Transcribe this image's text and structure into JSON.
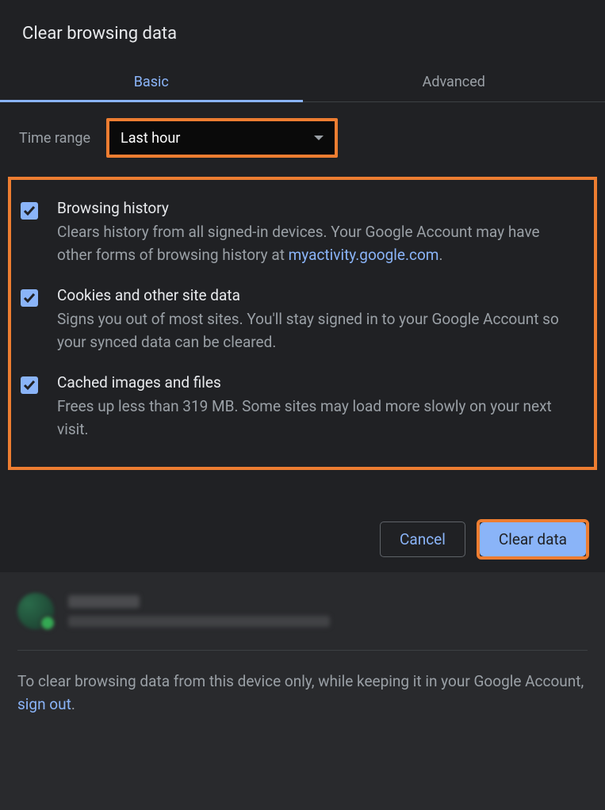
{
  "dialog": {
    "title": "Clear browsing data"
  },
  "tabs": {
    "basic": "Basic",
    "advanced": "Advanced"
  },
  "timeRange": {
    "label": "Time range",
    "value": "Last hour"
  },
  "options": {
    "browsingHistory": {
      "title": "Browsing history",
      "descPrefix": "Clears history from all signed-in devices. Your Google Account may have other forms of browsing history at ",
      "link": "myactivity.google.com",
      "descSuffix": ".",
      "checked": true
    },
    "cookies": {
      "title": "Cookies and other site data",
      "desc": "Signs you out of most sites. You'll stay signed in to your Google Account so your synced data can be cleared.",
      "checked": true
    },
    "cache": {
      "title": "Cached images and files",
      "desc": "Frees up less than 319 MB. Some sites may load more slowly on your next visit.",
      "checked": true
    }
  },
  "buttons": {
    "cancel": "Cancel",
    "clear": "Clear data"
  },
  "footer": {
    "notePrefix": "To clear browsing data from this device only, while keeping it in your Google Account, ",
    "signOut": "sign out",
    "noteSuffix": "."
  }
}
